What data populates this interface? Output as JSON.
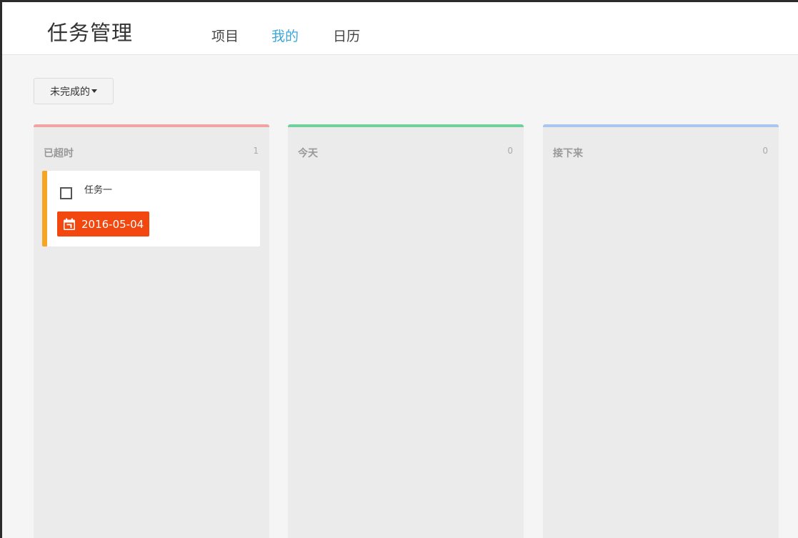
{
  "app": {
    "title": "任务管理"
  },
  "nav": {
    "items": [
      {
        "label": "项目",
        "active": false
      },
      {
        "label": "我的",
        "active": true
      },
      {
        "label": "日历",
        "active": false
      }
    ],
    "active_color": "#3aa8d8"
  },
  "filter": {
    "label": "未完成的"
  },
  "columns": [
    {
      "title": "已超时",
      "count": "1",
      "accent": "#f2a5a0",
      "tasks": [
        {
          "name": "任务一",
          "due": "2016-05-04",
          "due_color": "#f2470f",
          "priority_color": "#f5a623",
          "icon": "calendar-icon"
        }
      ]
    },
    {
      "title": "今天",
      "count": "0",
      "accent": "#6fd19c",
      "tasks": []
    },
    {
      "title": "接下来",
      "count": "0",
      "accent": "#a7c8ec",
      "tasks": []
    }
  ]
}
